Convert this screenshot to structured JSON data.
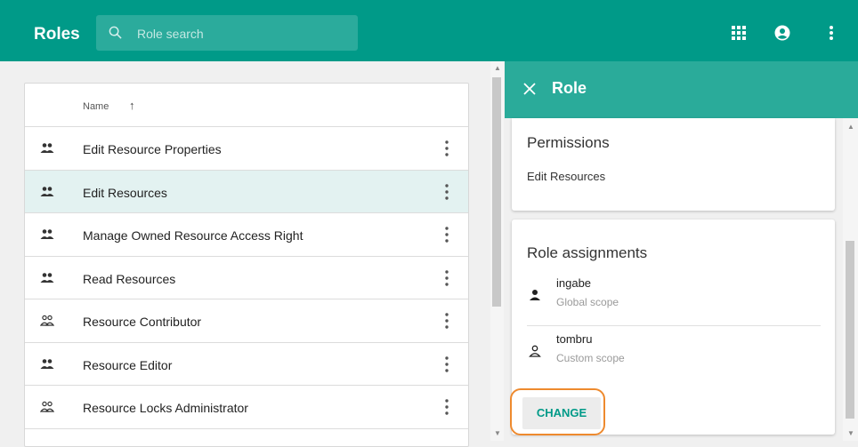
{
  "header": {
    "title": "Roles",
    "search_placeholder": "Role search",
    "icons": [
      "apps-grid-icon",
      "account-circle-icon",
      "more-vertical-icon"
    ],
    "background_color": "#009a88"
  },
  "list": {
    "column_header": "Name",
    "sort_indicator": "↑",
    "rows": [
      {
        "label": "Edit Resource Properties",
        "icon": "group-filled-icon",
        "selected": false
      },
      {
        "label": "Edit Resources",
        "icon": "group-filled-icon",
        "selected": true
      },
      {
        "label": "Manage Owned Resource Access Right",
        "icon": "group-filled-icon",
        "selected": false
      },
      {
        "label": "Read Resources",
        "icon": "group-filled-icon",
        "selected": false
      },
      {
        "label": "Resource Contributor",
        "icon": "group-outline-icon",
        "selected": false
      },
      {
        "label": "Resource Editor",
        "icon": "group-filled-icon",
        "selected": false
      },
      {
        "label": "Resource Locks Administrator",
        "icon": "group-outline-icon",
        "selected": false
      }
    ]
  },
  "panel": {
    "title": "Role",
    "permissions": {
      "heading": "Permissions",
      "value": "Edit Resources"
    },
    "assignments": {
      "heading": "Role assignments",
      "items": [
        {
          "name": "ingabe",
          "scope": "Global scope",
          "icon": "person-filled-icon"
        },
        {
          "name": "tombru",
          "scope": "Custom scope",
          "icon": "person-outline-icon"
        }
      ],
      "change_label": "CHANGE"
    },
    "header_color": "#2aab9a",
    "highlight_color": "#ee8a2e"
  }
}
